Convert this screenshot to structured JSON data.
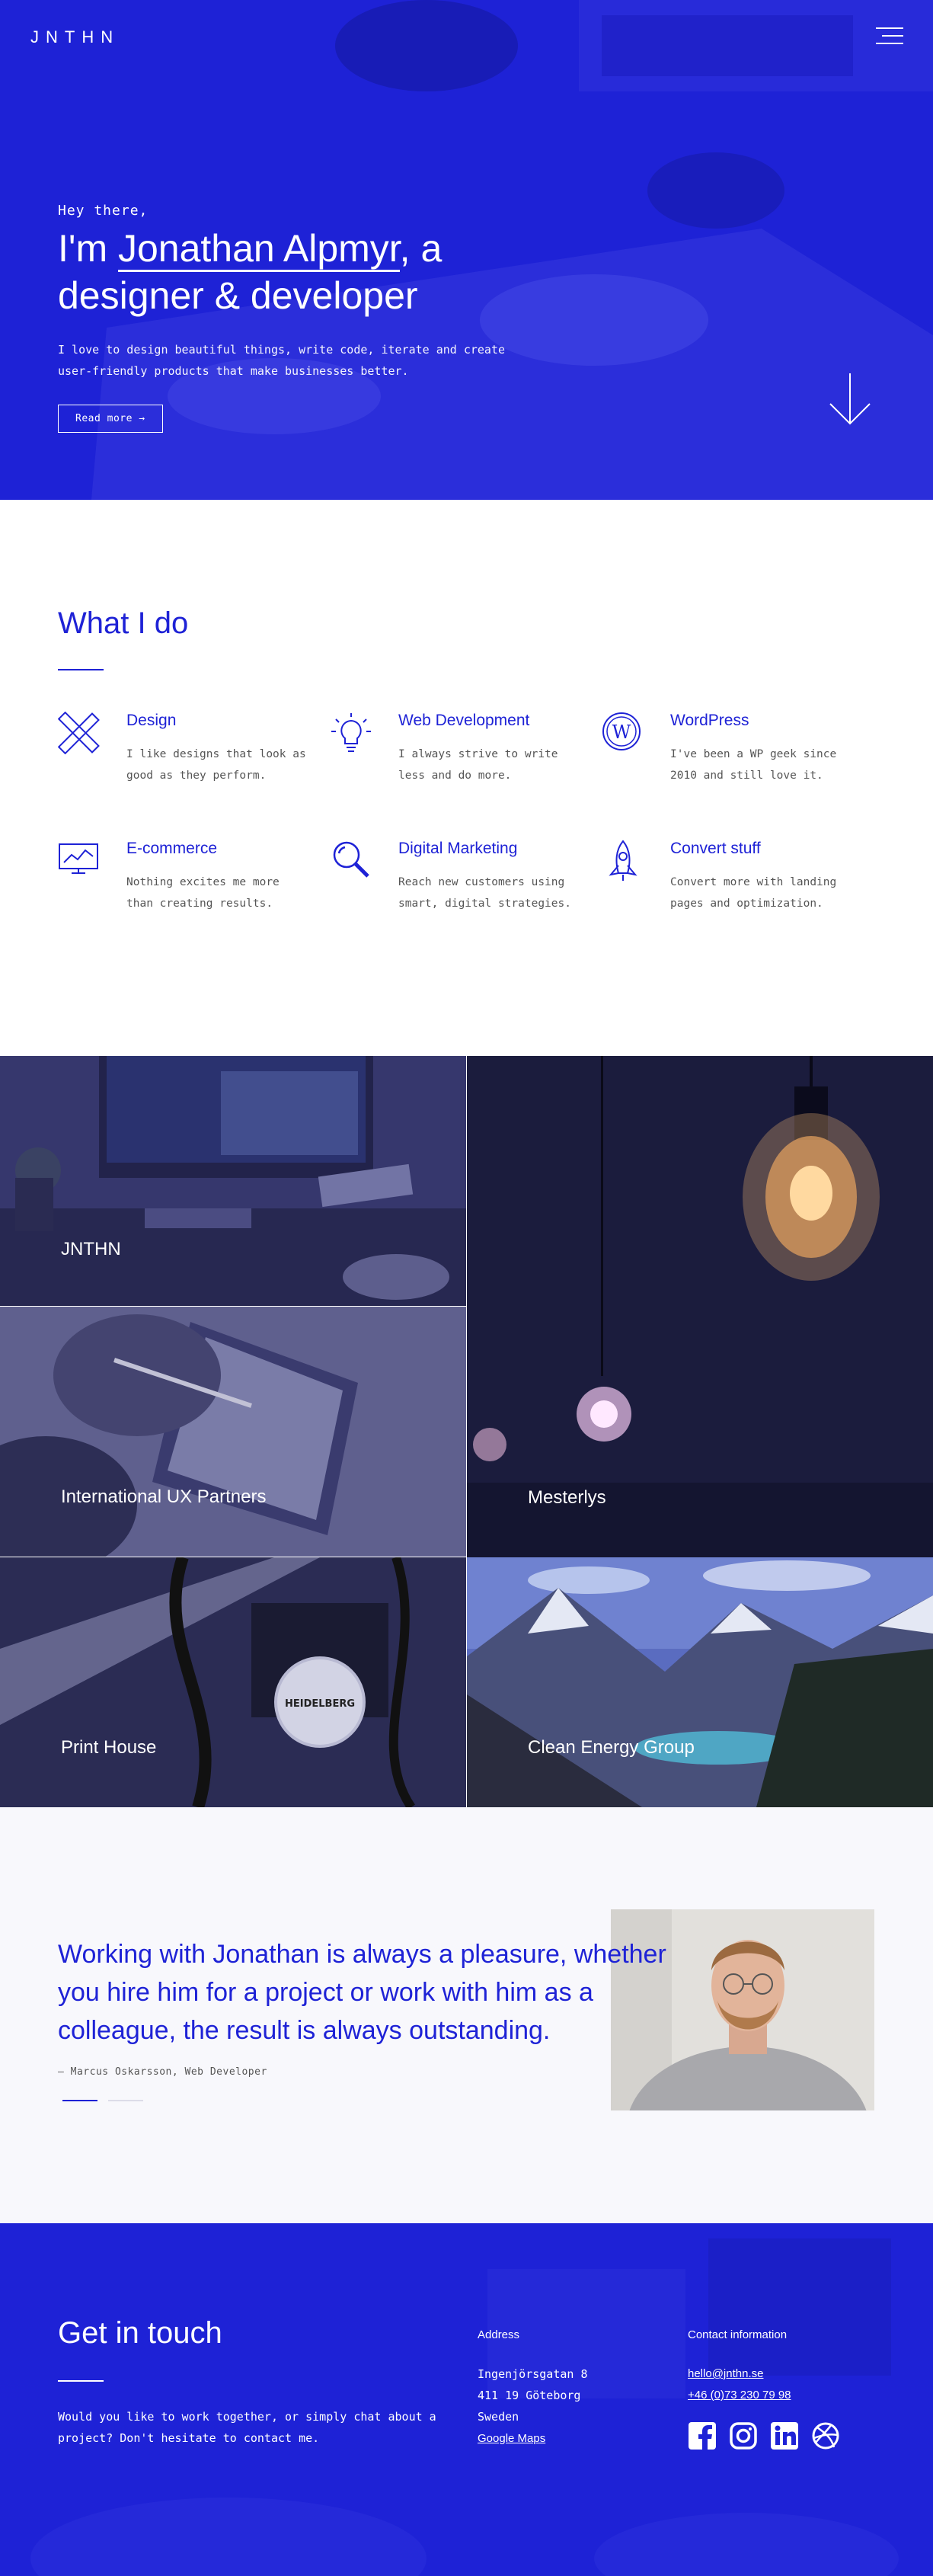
{
  "header": {
    "logo": "JNTHN",
    "menu_icon": "hamburger-menu-icon"
  },
  "hero": {
    "greeting": "Hey there,",
    "title_prefix": "I'm ",
    "title_name": "Jonathan Alpmyr",
    "title_suffix": ", a designer & developer",
    "intro": "I love to design beautiful things, write code, iterate and create user-friendly products that make businesses better.",
    "cta": "Read more →",
    "scroll_icon": "arrow-down-icon"
  },
  "services": {
    "title": "What I do",
    "items": [
      {
        "name": "Design",
        "desc": "I like designs that look as good as they perform.",
        "icon": "pencil-ruler-icon"
      },
      {
        "name": "Web Development",
        "desc": "I always strive to write less and do more.",
        "icon": "lightbulb-icon"
      },
      {
        "name": "WordPress",
        "desc": "I've been a WP geek since 2010 and still love it.",
        "icon": "wordpress-icon"
      },
      {
        "name": "E-commerce",
        "desc": "Nothing excites me more than creating results.",
        "icon": "chart-monitor-icon"
      },
      {
        "name": "Digital Marketing",
        "desc": "Reach new customers using smart, digital strategies.",
        "icon": "magnifier-icon"
      },
      {
        "name": "Convert stuff",
        "desc": "Convert more with landing pages and optimization.",
        "icon": "rocket-icon"
      }
    ]
  },
  "portfolio": {
    "items": [
      {
        "label": "JNTHN"
      },
      {
        "label": "Mesterlys"
      },
      {
        "label": "International UX Partners"
      },
      {
        "label": "Print House"
      },
      {
        "label": "Clean Energy Group"
      }
    ]
  },
  "testimonial": {
    "quote": "Working with Jonathan is always a pleasure, whether you hire him for a project or work with him as a colleague, the result is always outstanding.",
    "author": "– Marcus Oskarsson, Web Developer"
  },
  "footer": {
    "title": "Get in touch",
    "blurb": "Would you like to work together, or simply chat about a project? Don't hesitate to contact me.",
    "address_title": "Address",
    "address_lines": [
      "Ingenjörsgatan 8",
      "411 19 Göteborg",
      "Sweden"
    ],
    "maps_link": "Google Maps",
    "contact_title": "Contact information",
    "email": "hello@jnthn.se",
    "phone": "+46 (0)73 230 79 98",
    "social_icons": [
      "facebook-icon",
      "instagram-icon",
      "linkedin-icon",
      "dribbble-icon"
    ]
  },
  "colors": {
    "brand_blue": "#1e22d6",
    "text_gray": "#555555",
    "tile_overlay": "#2a2a6a"
  }
}
